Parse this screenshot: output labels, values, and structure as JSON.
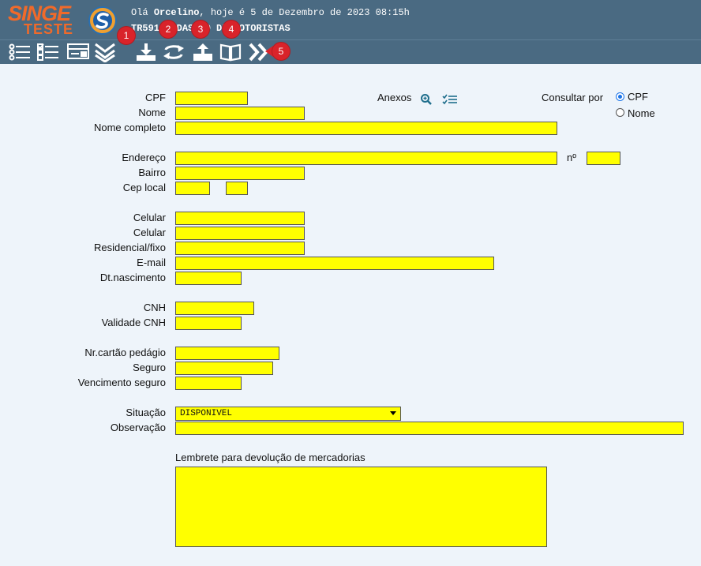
{
  "brand": {
    "name": "SINGE",
    "env": "TESTE",
    "logo_letter": "S"
  },
  "header": {
    "greeting_prefix": "Olá ",
    "user": "Orcelino",
    "greeting_suffix": ", hoje é 5 de Dezembro de 2023 08:15h",
    "screen_code": "TR591",
    "screen_title": "CADASTRO DE MOTORISTAS"
  },
  "toolbar": {
    "icons": [
      "list-icon",
      "checklist-icon",
      "card-icon",
      "double-chevron-down-icon",
      "download-icon",
      "refresh-icon",
      "upload-icon",
      "book-icon",
      "forward-icon"
    ],
    "badges": [
      "1",
      "2",
      "3",
      "4",
      "5"
    ]
  },
  "form": {
    "cpf_label": "CPF",
    "nome_label": "Nome",
    "nome_completo_label": "Nome completo",
    "anexos_label": "Anexos",
    "consultar_label": "Consultar por",
    "consultar_options": [
      "CPF",
      "Nome"
    ],
    "consultar_selected": "CPF",
    "endereco_label": "Endereço",
    "numero_label": "nº",
    "bairro_label": "Bairro",
    "cep_label": "Cep local",
    "celular1_label": "Celular",
    "celular2_label": "Celular",
    "residencial_label": "Residencial/fixo",
    "email_label": "E-mail",
    "nascimento_label": "Dt.nascimento",
    "cnh_label": "CNH",
    "validade_cnh_label": "Validade CNH",
    "cartao_pedagio_label": "Nr.cartão pedágio",
    "seguro_label": "Seguro",
    "venc_seguro_label": "Vencimento seguro",
    "situacao_label": "Situação",
    "situacao_value": "DISPONIVEL",
    "observacao_label": "Observação",
    "lembrete_label": "Lembrete para devolução de mercadorias"
  },
  "colors": {
    "header_bg": "#4a6a82",
    "field_bg": "#ffff00",
    "page_bg": "#eef4fa",
    "badge": "#d9232a",
    "brand": "#f06a2a"
  }
}
